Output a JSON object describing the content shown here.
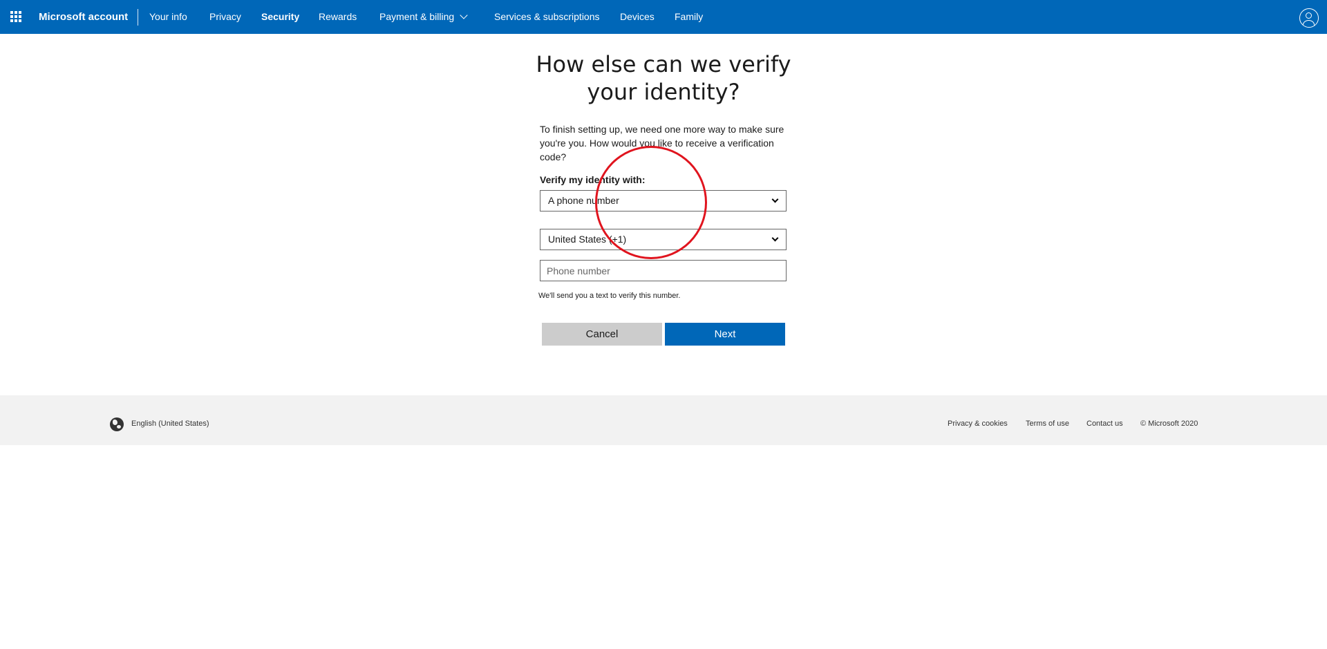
{
  "nav": {
    "brand": "Microsoft account",
    "items": [
      {
        "label": "Your info"
      },
      {
        "label": "Privacy"
      },
      {
        "label": "Security"
      },
      {
        "label": "Rewards"
      },
      {
        "label": "Payment & billing"
      },
      {
        "label": "Services & subscriptions"
      },
      {
        "label": "Devices"
      },
      {
        "label": "Family"
      }
    ],
    "active_item": "Security"
  },
  "main": {
    "title": "How else can we verify your identity?",
    "intro": "To finish setting up, we need one more way to make sure you're you. How would you like to receive a verification code?",
    "verify_label": "Verify my identity with:",
    "method_value": "A phone number",
    "country_value": "United States (+1)",
    "phone_placeholder": "Phone number",
    "phone_value": "",
    "hint": "We'll send you a text to verify this number.",
    "cancel_label": "Cancel",
    "next_label": "Next"
  },
  "footer": {
    "locale": "English (United States)",
    "links": [
      {
        "label": "Privacy & cookies"
      },
      {
        "label": "Terms of use"
      },
      {
        "label": "Contact us"
      }
    ],
    "copyright": "© Microsoft 2020"
  },
  "colors": {
    "brand_blue": "#0067b8",
    "annotation_red": "#e0141e",
    "cancel_gray": "#cccccc",
    "footer_bg": "#f2f2f2"
  }
}
